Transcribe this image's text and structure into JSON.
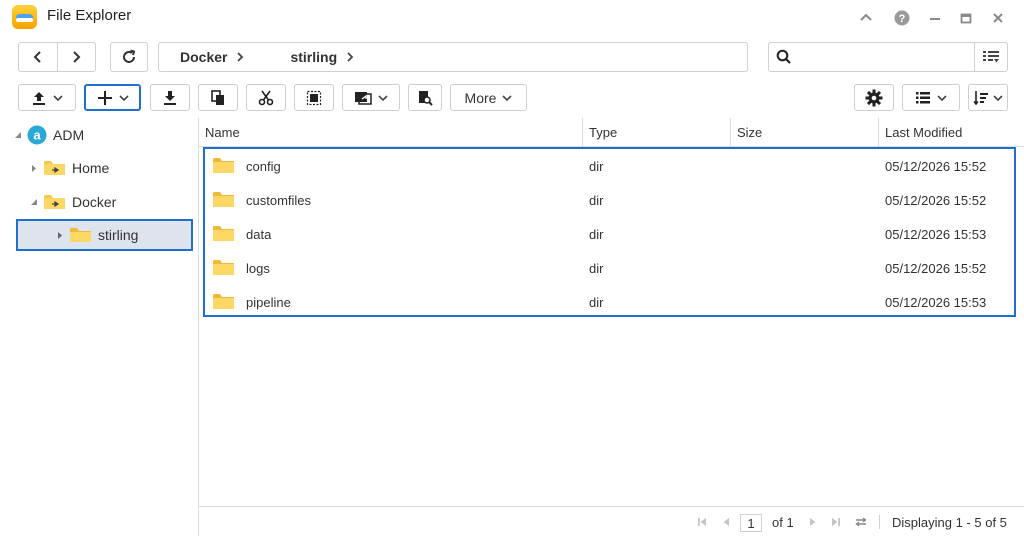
{
  "window": {
    "title": "File Explorer"
  },
  "breadcrumb": [
    "Docker",
    "stirling"
  ],
  "search": {
    "value": "",
    "placeholder": ""
  },
  "toolbar": {
    "more_label": "More"
  },
  "tree": {
    "root": "ADM",
    "items": [
      {
        "label": "Home",
        "expanded": false
      },
      {
        "label": "Docker",
        "expanded": true
      },
      {
        "label": "stirling",
        "expanded": false,
        "selected": true
      }
    ]
  },
  "columns": {
    "name": "Name",
    "type": "Type",
    "size": "Size",
    "modified": "Last Modified"
  },
  "files": [
    {
      "name": "config",
      "type": "dir",
      "size": "",
      "modified": "05/12/2026 15:52"
    },
    {
      "name": "customfiles",
      "type": "dir",
      "size": "",
      "modified": "05/12/2026 15:52"
    },
    {
      "name": "data",
      "type": "dir",
      "size": "",
      "modified": "05/12/2026 15:53"
    },
    {
      "name": "logs",
      "type": "dir",
      "size": "",
      "modified": "05/12/2026 15:52"
    },
    {
      "name": "pipeline",
      "type": "dir",
      "size": "",
      "modified": "05/12/2026 15:53"
    }
  ],
  "pagination": {
    "page": "1",
    "of_label": "of 1",
    "display": "Displaying 1 - 5 of 5"
  },
  "colors": {
    "accent": "#1f6fd1",
    "selection": "#dde4ee",
    "folder": "#f7c948"
  }
}
